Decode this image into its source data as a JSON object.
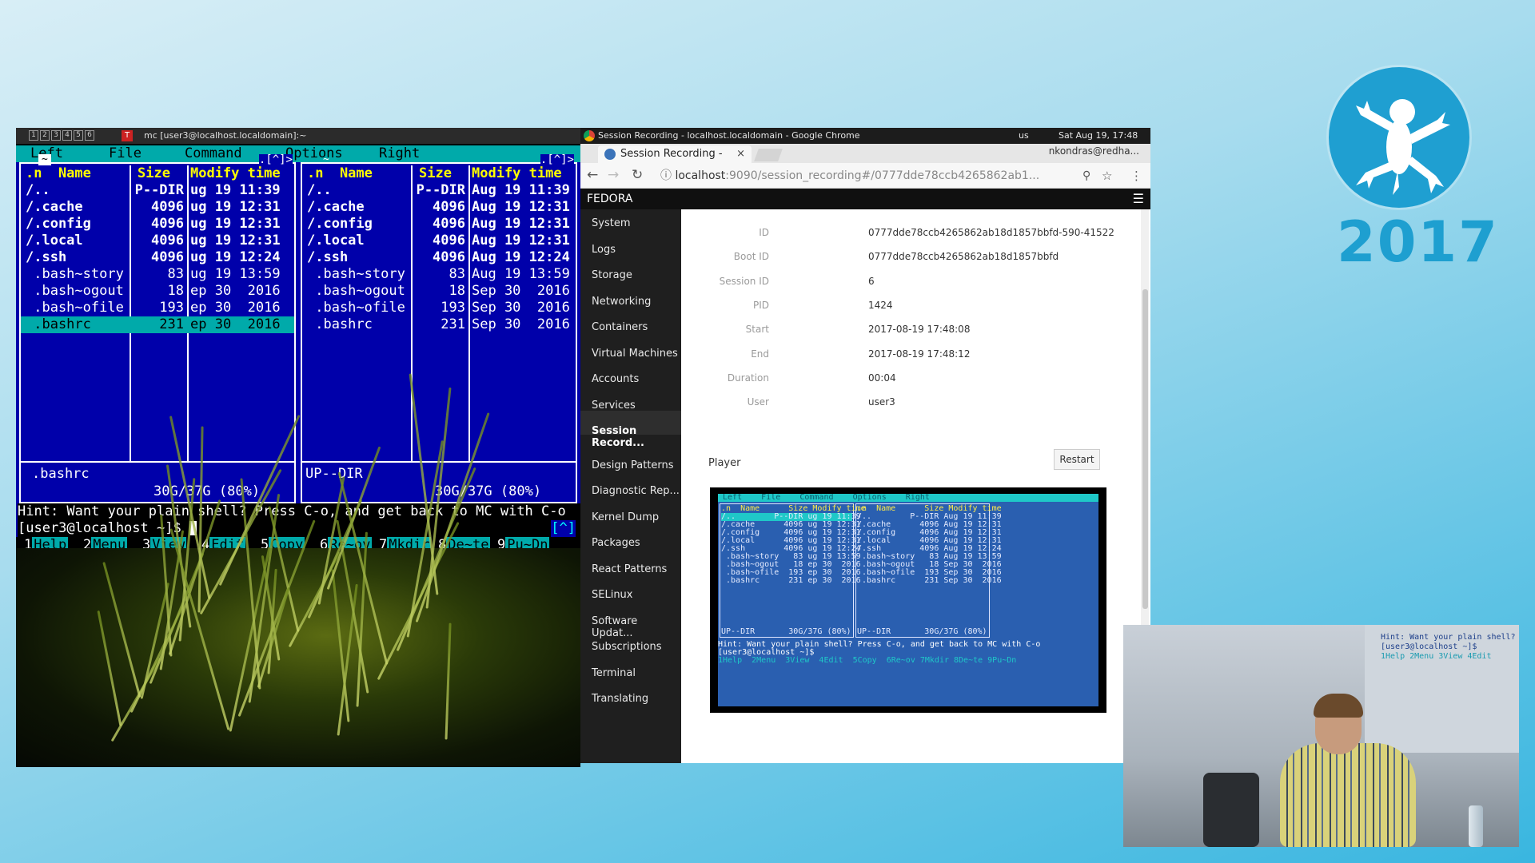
{
  "event": {
    "year": "2017"
  },
  "terminal": {
    "window_title": "mc [user3@localhost.localdomain]:~",
    "workspaces": [
      "1",
      "2",
      "3",
      "4",
      "5",
      "6"
    ],
    "menu": [
      "Left",
      "File",
      "Command",
      "Options",
      "Right"
    ],
    "left_panel": {
      "path_marker": "~",
      "corner": ".[^]>",
      "headers": {
        "name": ".n  Name",
        "size": "Size",
        "mtime": "Modify time"
      },
      "rows": [
        {
          "name": "/..",
          "size": "P--DIR",
          "mtime": "ug 19 11:39"
        },
        {
          "name": "/.cache",
          "size": "4096",
          "mtime": "ug 19 12:31"
        },
        {
          "name": "/.config",
          "size": "4096",
          "mtime": "ug 19 12:31"
        },
        {
          "name": "/.local",
          "size": "4096",
          "mtime": "ug 19 12:31"
        },
        {
          "name": "/.ssh",
          "size": "4096",
          "mtime": "ug 19 12:24"
        },
        {
          "name": " .bash~story",
          "size": "83",
          "mtime": "ug 19 13:59"
        },
        {
          "name": " .bash~ogout",
          "size": "18",
          "mtime": "ep 30  2016"
        },
        {
          "name": " .bash~ofile",
          "size": "193",
          "mtime": "ep 30  2016"
        },
        {
          "name": " .bashrc",
          "size": "231",
          "mtime": "ep 30  2016"
        }
      ],
      "selected_index": 8,
      "mini_status": ".bashrc",
      "disk": "30G/37G (80%)"
    },
    "right_panel": {
      "path_marker": "~",
      "corner": ".[^]>",
      "headers": {
        "name": ".n  Name",
        "size": "Size",
        "mtime": "Modify time"
      },
      "rows": [
        {
          "name": "/..",
          "size": "P--DIR",
          "mtime": "Aug 19 11:39"
        },
        {
          "name": "/.cache",
          "size": "4096",
          "mtime": "Aug 19 12:31"
        },
        {
          "name": "/.config",
          "size": "4096",
          "mtime": "Aug 19 12:31"
        },
        {
          "name": "/.local",
          "size": "4096",
          "mtime": "Aug 19 12:31"
        },
        {
          "name": "/.ssh",
          "size": "4096",
          "mtime": "Aug 19 12:24"
        },
        {
          "name": " .bash~story",
          "size": "83",
          "mtime": "Aug 19 13:59"
        },
        {
          "name": " .bash~ogout",
          "size": "18",
          "mtime": "Sep 30  2016"
        },
        {
          "name": " .bash~ofile",
          "size": "193",
          "mtime": "Sep 30  2016"
        },
        {
          "name": " .bashrc",
          "size": "231",
          "mtime": "Sep 30  2016"
        }
      ],
      "mini_status": "UP--DIR",
      "disk": "30G/37G (80%)"
    },
    "hint": "Hint: Want your plain shell? Press C-o, and get back to MC with C-o",
    "prompt": "[user3@localhost ~]$ ",
    "arrow_tag": "[^]",
    "fkeys": [
      {
        "n": "1",
        "label": "Help"
      },
      {
        "n": "2",
        "label": "Menu"
      },
      {
        "n": "3",
        "label": "View"
      },
      {
        "n": "4",
        "label": "Edit"
      },
      {
        "n": "5",
        "label": "Copy"
      },
      {
        "n": "6",
        "label": "Re~ov"
      },
      {
        "n": "7",
        "label": "Mkdir"
      },
      {
        "n": "8",
        "label": "De~te"
      },
      {
        "n": "9",
        "label": "Pu~Dn"
      }
    ]
  },
  "chrome": {
    "window_title": "Session Recording - localhost.localdomain - Google Chrome",
    "keyboard": "us",
    "clock": "Sat Aug 19, 17:48",
    "tab_title": "Session Recording -",
    "tab_close": "×",
    "profile": "nkondras@redha...",
    "url_host": "localhost",
    "url_rest": ":9090/session_recording#/0777dde78ccb4265862ab1...",
    "cockpit_brand": "FEDORA",
    "sidebar": [
      "System",
      "Logs",
      "Storage",
      "Networking",
      "Containers",
      "Virtual Machines",
      "Accounts",
      "Services",
      "Session Record...",
      "Design Patterns",
      "Diagnostic Rep...",
      "Kernel Dump",
      "Packages",
      "React Patterns",
      "SELinux",
      "Software Updat...",
      "Subscriptions",
      "Terminal",
      "Translating"
    ],
    "active_sidebar": "Session Record...",
    "details": [
      {
        "label": "ID",
        "value": "0777dde78ccb4265862ab18d1857bbfd-590-41522"
      },
      {
        "label": "Boot ID",
        "value": "0777dde78ccb4265862ab18d1857bbfd"
      },
      {
        "label": "Session ID",
        "value": "6"
      },
      {
        "label": "PID",
        "value": "1424"
      },
      {
        "label": "Start",
        "value": "2017-08-19 17:48:08"
      },
      {
        "label": "End",
        "value": "2017-08-19 17:48:12"
      },
      {
        "label": "Duration",
        "value": "00:04"
      },
      {
        "label": "User",
        "value": "user3"
      }
    ],
    "player_label": "Player",
    "restart_label": "Restart",
    "player_screen": {
      "menu": " Left    File    Command    Options    Right",
      "left_lines": [
        ".n  Name      Size Modify time",
        "/..        P--DIR ug 19 11:39",
        "/.cache      4096 ug 19 12:31",
        "/.config     4096 ug 19 12:31",
        "/.local      4096 ug 19 12:31",
        "/.ssh        4096 ug 19 12:24",
        " .bash~story   83 ug 19 13:59",
        " .bash~ogout   18 ep 30  2016",
        " .bash~ofile  193 ep 30  2016",
        " .bashrc      231 ep 30  2016"
      ],
      "right_lines": [
        ".n  Name      Size Modify time",
        "/..        P--DIR Aug 19 11:39",
        "/.cache      4096 Aug 19 12:31",
        "/.config     4096 Aug 19 12:31",
        "/.local      4096 Aug 19 12:31",
        "/.ssh        4096 Aug 19 12:24",
        " .bash~story   83 Aug 19 13:59",
        " .bash~ogout   18 Sep 30  2016",
        " .bash~ofile  193 Sep 30  2016",
        " .bashrc      231 Sep 30  2016"
      ],
      "left_status": "UP--DIR       30G/37G (80%)",
      "right_status": "UP--DIR       30G/37G (80%)",
      "hint": "Hint: Want your plain shell? Press C-o, and get back to MC with C-o",
      "prompt": "[user3@localhost ~]$",
      "fkeys": "1Help  2Menu  3View  4Edit  5Copy  6Re~ov 7Mkdir 8De~te 9Pu~Dn"
    }
  },
  "camera": {
    "projection_lines": [
      "Hint: Want your plain shell? Pre",
      "[user3@localhost ~]$",
      "1Help 2Menu 3View 4Edit"
    ]
  },
  "colors": {
    "mc_blue": "#0000aa",
    "mc_cyan": "#00aaaa",
    "mc_yellow": "#ffff00",
    "brand_blue": "#1f9fd1"
  }
}
